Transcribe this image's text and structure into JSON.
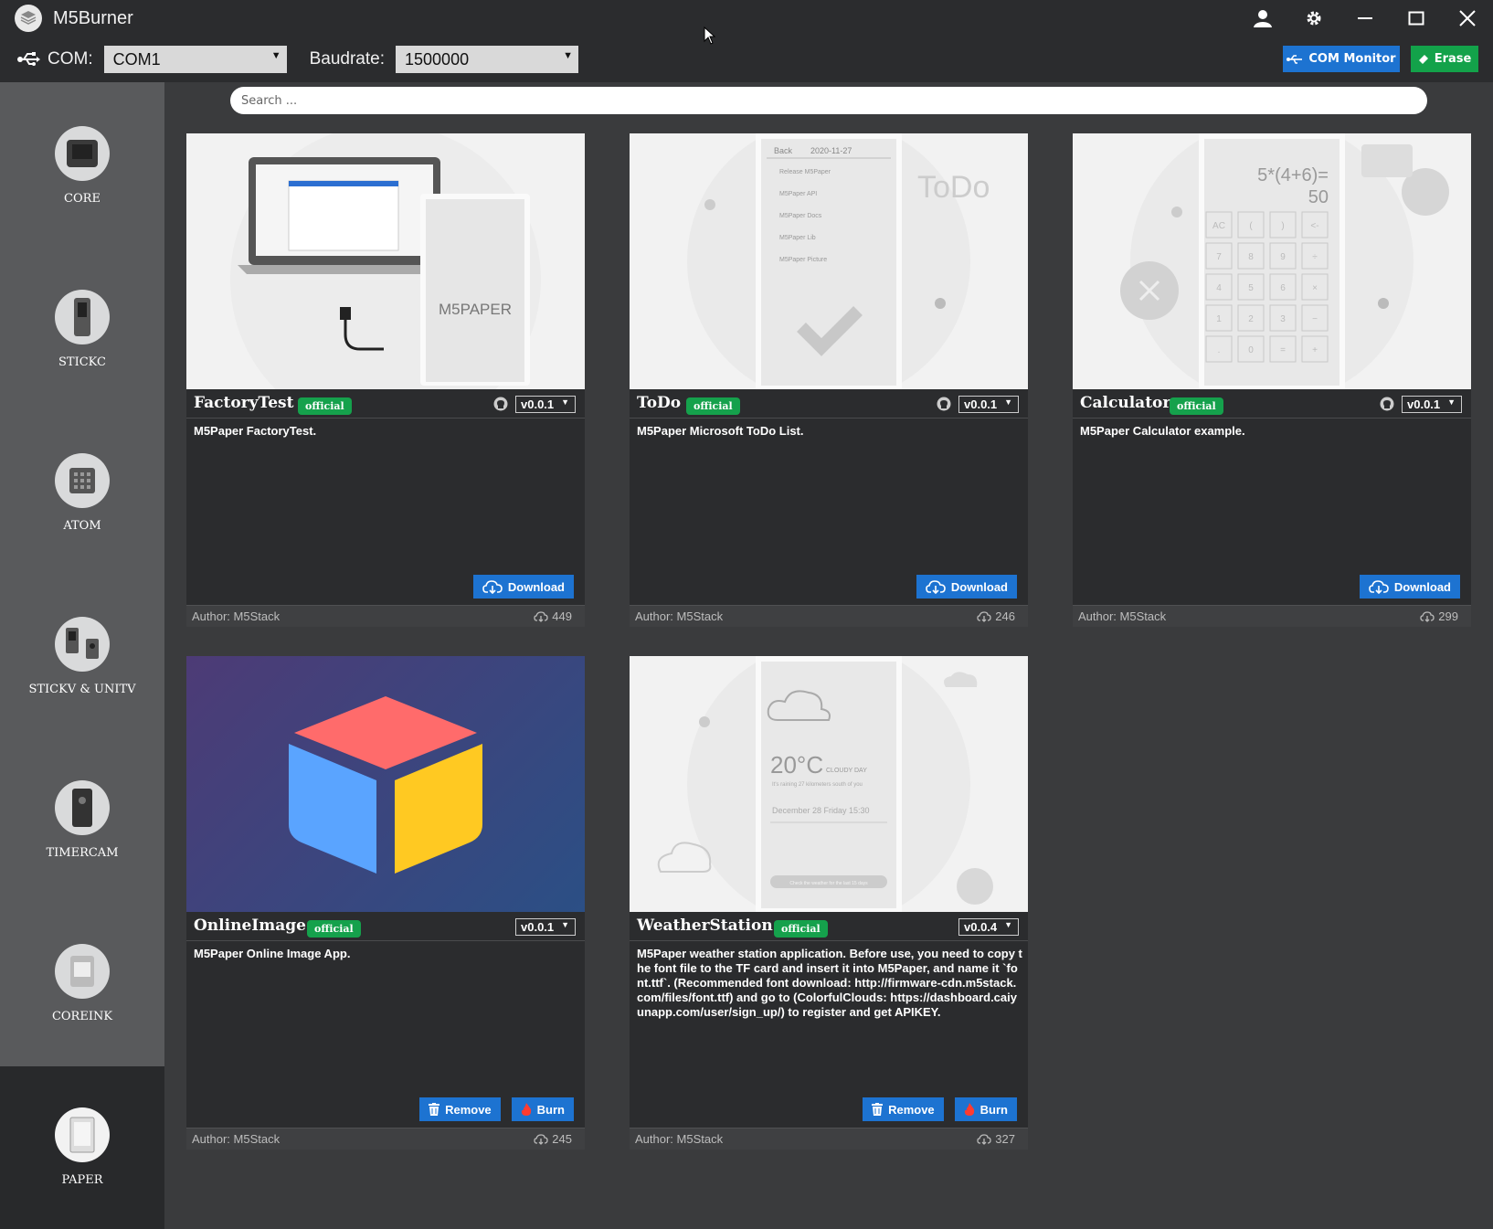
{
  "app": {
    "title": "M5Burner"
  },
  "toolbar": {
    "com_label": "COM:",
    "com_value": "COM1",
    "baud_label": "Baudrate:",
    "baud_value": "1500000",
    "com_monitor": "COM Monitor",
    "erase": "Erase"
  },
  "search": {
    "placeholder": "Search ..."
  },
  "sidebar": {
    "items": [
      {
        "label": "CORE"
      },
      {
        "label": "STICKC"
      },
      {
        "label": "ATOM"
      },
      {
        "label": "STICKV & UNITV"
      },
      {
        "label": "TIMERCAM"
      },
      {
        "label": "COREINK"
      },
      {
        "label": "PAPER"
      }
    ]
  },
  "cards": [
    {
      "name": "FactoryTest",
      "badge": "official",
      "version": "v0.0.1",
      "description": "M5Paper FactoryTest.",
      "action": "Download",
      "author": "Author: M5Stack",
      "downloads": "449",
      "image_text": "M5PAPER"
    },
    {
      "name": "ToDo",
      "badge": "official",
      "version": "v0.0.1",
      "description": "M5Paper Microsoft ToDo List.",
      "action": "Download",
      "author": "Author: M5Stack",
      "downloads": "246",
      "image_text": "ToDo",
      "image_back": "Back",
      "image_date": "2020-11-27",
      "image_items": [
        "Release M5Paper",
        "M5Paper API",
        "M5Paper Docs",
        "M5Paper Lib",
        "M5Paper Picture"
      ]
    },
    {
      "name": "Calculator",
      "badge": "official",
      "version": "v0.0.1",
      "description": "M5Paper Calculator example.",
      "action": "Download",
      "author": "Author: M5Stack",
      "downloads": "299",
      "image_expr": "5*(4+6)=",
      "image_result": "50",
      "image_keys": [
        "AC",
        "(",
        ")",
        "<-",
        "7",
        "8",
        "9",
        "÷",
        "4",
        "5",
        "6",
        "×",
        "1",
        "2",
        "3",
        "−",
        ".",
        "0",
        "=",
        "+"
      ]
    },
    {
      "name": "OnlineImage",
      "badge": "official",
      "version": "v0.0.1",
      "description": "M5Paper Online Image App.",
      "remove": "Remove",
      "burn": "Burn",
      "author": "Author: M5Stack",
      "downloads": "245"
    },
    {
      "name": "WeatherStation",
      "badge": "official",
      "version": "v0.0.4",
      "description": "M5Paper weather station application. Before use, you need to copy the font file to the TF card and insert it into M5Paper, and name it `font.ttf`. (Recommended font download: http://firmware-cdn.m5stack.com/files/font.ttf) and go to (ColorfulClouds: https://dashboard.caiyunapp.com/user/sign_up/) to register and get APIKEY.",
      "remove": "Remove",
      "burn": "Burn",
      "author": "Author: M5Stack",
      "downloads": "327",
      "image_temp": "20°C",
      "image_cond": "CLOUDY DAY",
      "image_sub": "It's raining 27 kilometers south of you",
      "image_date": "December 28  Friday  15:30",
      "image_btn": "Check the weather for the last 15 days"
    }
  ]
}
